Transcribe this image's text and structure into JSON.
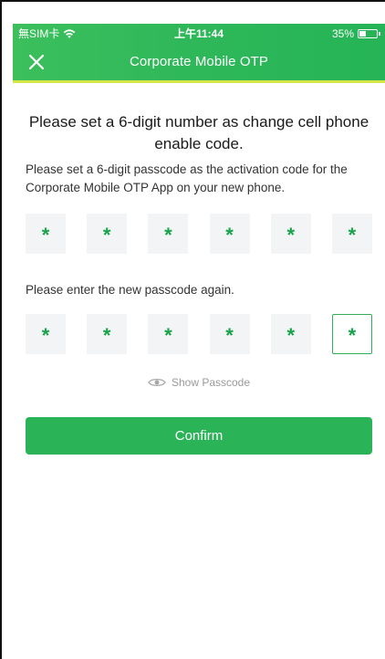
{
  "status_bar": {
    "carrier": "無SIM卡",
    "time": "上午11:44",
    "battery": "35%"
  },
  "nav": {
    "title": "Corporate Mobile OTP",
    "close_icon": "close-icon"
  },
  "main": {
    "title": "Please set a 6-digit number as change cell phone enable code.",
    "description": "Please set a 6-digit passcode as the activation code for the Corporate Mobile OTP App on your new phone.",
    "passcode1": [
      "*",
      "*",
      "*",
      "*",
      "*",
      "*"
    ],
    "reenter_label": "Please enter the new passcode again.",
    "passcode2": [
      "*",
      "*",
      "*",
      "*",
      "*",
      "*"
    ],
    "active_index": 5,
    "show_passcode_label": "Show Passcode",
    "confirm_label": "Confirm"
  },
  "colors": {
    "brand_green": "#2bb457",
    "accent_yellow": "#d6e64a",
    "mask_green": "#16a34a"
  }
}
